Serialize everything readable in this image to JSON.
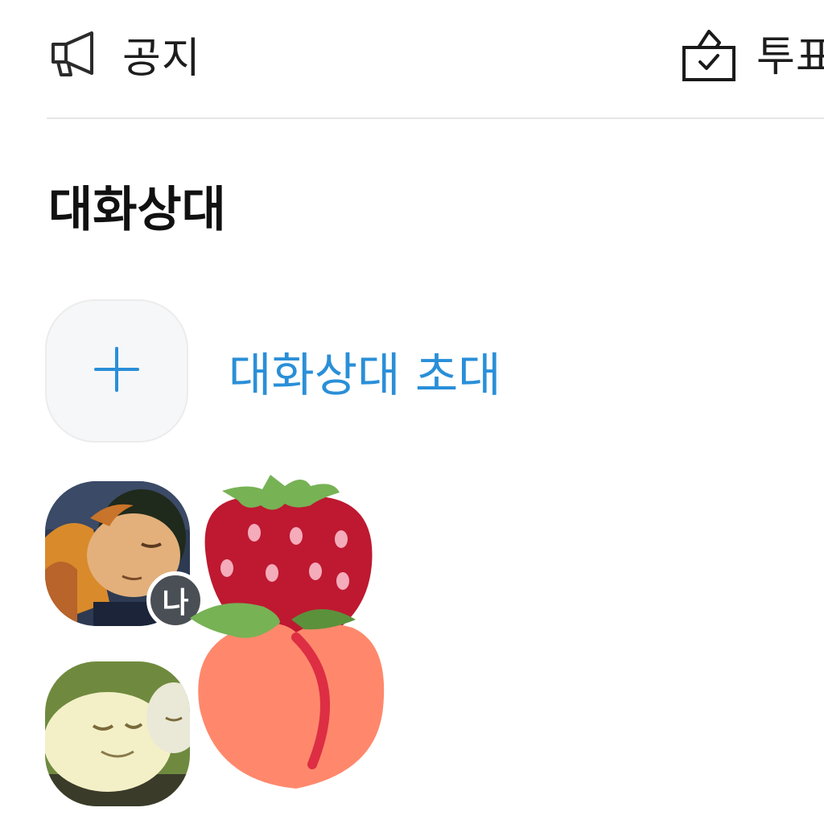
{
  "menu": {
    "notice": {
      "label": "공지",
      "icon": "megaphone-icon"
    },
    "vote": {
      "label": "투표",
      "icon": "ballot-box-icon"
    }
  },
  "section": {
    "title": "대화상대"
  },
  "invite": {
    "label": "대화상대 초대",
    "icon": "plus-icon"
  },
  "members": [
    {
      "badge": "나",
      "avatar": "cartoon-character-avatar"
    },
    {
      "avatar": "cartoon-creature-avatar"
    }
  ],
  "stickers": [
    "strawberry-sticker",
    "peach-sticker"
  ],
  "colors": {
    "accent": "#2a8fd8",
    "text": "#1d1d1d",
    "divider": "#e6e6e6",
    "badge": "#4a4f56"
  }
}
